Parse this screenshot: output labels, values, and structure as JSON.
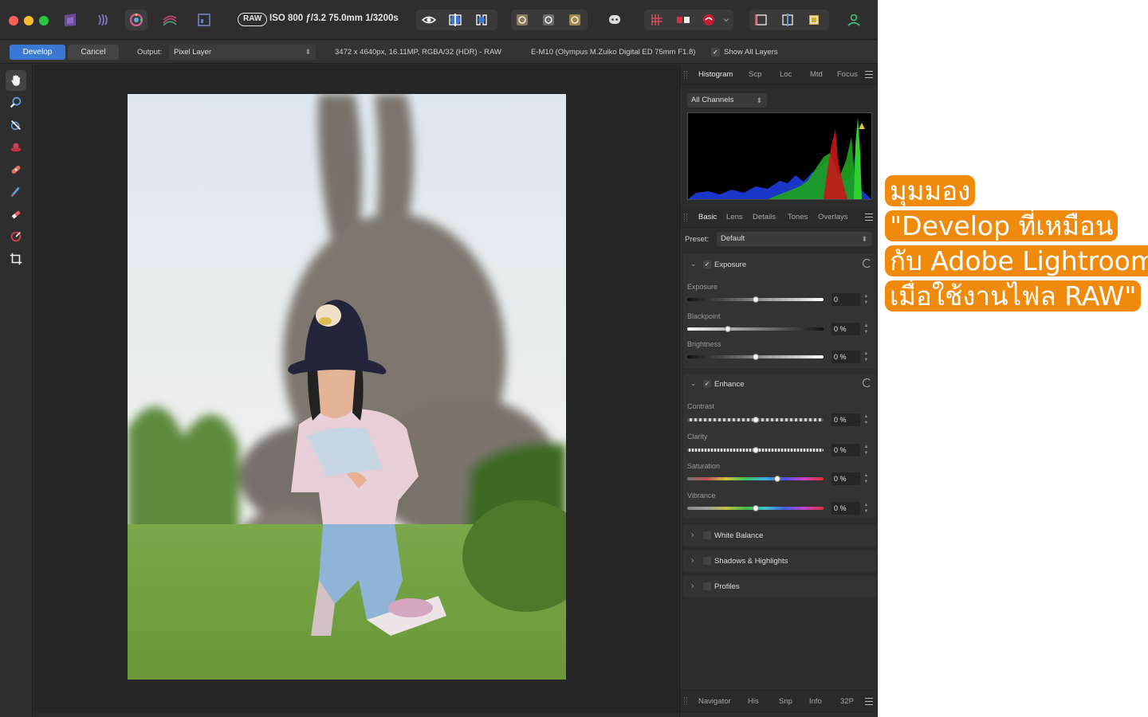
{
  "toolbar": {
    "raw_badge": "RAW",
    "exif": "ISO 800 ƒ/3.2 75.0mm 1/3200s"
  },
  "context": {
    "develop_label": "Develop",
    "cancel_label": "Cancel",
    "output_label": "Output:",
    "output_value": "Pixel Layer",
    "image_info": "3472 x 4640px, 16.11MP, RGBA/32 (HDR) - RAW",
    "lens_info": "E-M10 (Olympus M.Zuiko Digital ED 75mm F1.8)",
    "show_all_layers": "Show All Layers"
  },
  "panel_top": {
    "tabs": [
      "Histogram",
      "Scp",
      "Loc",
      "Mtd",
      "Focus"
    ],
    "channel_select": "All Channels"
  },
  "panel_basic": {
    "tabs": [
      "Basic",
      "Lens",
      "Details",
      "Tones",
      "Overlays"
    ],
    "preset_label": "Preset:",
    "preset_value": "Default"
  },
  "exposure_group": {
    "title": "Exposure",
    "sliders": [
      {
        "label": "Exposure",
        "value": "0",
        "position": 0.5
      },
      {
        "label": "Blackpoint",
        "value": "0 %",
        "position": 0.3
      },
      {
        "label": "Brightness",
        "value": "0 %",
        "position": 0.5
      }
    ]
  },
  "enhance_group": {
    "title": "Enhance",
    "sliders": [
      {
        "label": "Contrast",
        "value": "0 %",
        "position": 0.5
      },
      {
        "label": "Clarity",
        "value": "0 %",
        "position": 0.5
      },
      {
        "label": "Saturation",
        "value": "0 %",
        "position": 0.66
      },
      {
        "label": "Vibrance",
        "value": "0 %",
        "position": 0.5
      }
    ]
  },
  "collapsed_groups": [
    "White Balance",
    "Shadows & Highlights",
    "Profiles"
  ],
  "bottom_tabs": [
    "Navigator",
    "His",
    "Snp",
    "Info",
    "32P"
  ],
  "annotation": {
    "lines": [
      "มุมมอง",
      "\"Develop ที่เหมือน",
      "กับ Adobe Lightroom",
      "เมื่อใช้งานไฟล RAW\""
    ]
  },
  "colors": {
    "accent": "#3a78d6",
    "annotation_bg": "#f08a0c",
    "traffic_red": "#ff5f57",
    "traffic_yellow": "#febc2e",
    "traffic_green": "#28c840"
  }
}
